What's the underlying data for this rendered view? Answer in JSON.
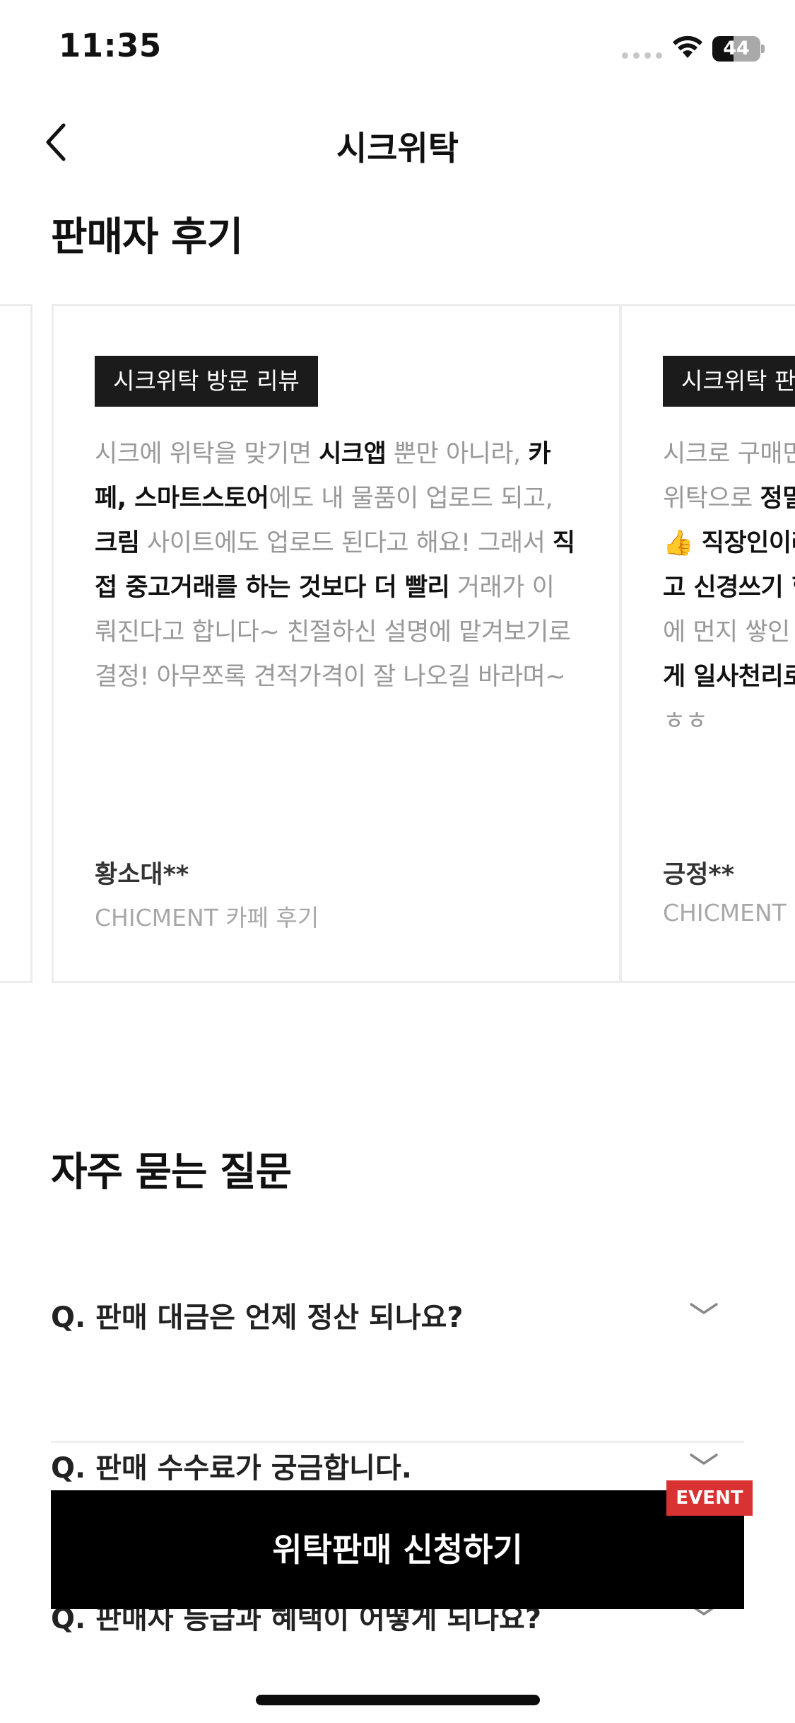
{
  "status_bar": {
    "time": "11:35",
    "battery_level": "44",
    "battery_fraction": 0.44
  },
  "nav": {
    "title": "시크위탁",
    "back_icon": "chevron-left-icon"
  },
  "reviews": {
    "title": "판매자 후기",
    "cards": [
      {
        "tag": "",
        "segments": [],
        "author": "",
        "source": ""
      },
      {
        "tag": "시크위탁 방문 리뷰",
        "segments": [
          {
            "text": "시크에 위탁을 맞기면 ",
            "bold": false
          },
          {
            "text": "시크앱",
            "bold": true
          },
          {
            "text": " 뿐만 아니라, ",
            "bold": false
          },
          {
            "text": "카페, 스마트스토어",
            "bold": true
          },
          {
            "text": "에도 내 물품이 업로드 되고, ",
            "bold": false
          },
          {
            "text": "크림",
            "bold": true
          },
          {
            "text": " 사이트에도 업로드 된다고 해요! 그래서 ",
            "bold": false
          },
          {
            "text": "직접 중고거래를 하는 것보다 더 빨리",
            "bold": true
          },
          {
            "text": " 거래가 이뤄진다고 합니다~ 친절하신 설명에 맡겨보기로 결정! 아무쪼록 견적가격이 잘 나오길 바라며~",
            "bold": false
          }
        ],
        "author": "황소대**",
        "source": "CHICMENT 카페 후기"
      },
      {
        "tag": "시크위탁 판",
        "segments": [
          {
            "text": "시크로 구매민",
            "bold": false
          },
          {
            "text": "\n위탁으로 ",
            "bold": false
          },
          {
            "text": "정밀",
            "bold": true
          },
          {
            "text": "\n👍 직장인이라",
            "bold": true
          },
          {
            "text": "\n고 신경쓰기 힘",
            "bold": true
          },
          {
            "text": "\n에 먼지 쌓인 ",
            "bold": false
          },
          {
            "text": "\n게 일사천리로",
            "bold": true
          },
          {
            "text": "\nㅎㅎ",
            "bold": false
          }
        ],
        "author": "긍정**",
        "source": "CHICMENT"
      }
    ]
  },
  "faq": {
    "title": "자주 묻는 질문",
    "chevron_icon": "chevron-down-icon",
    "items": [
      {
        "q": "Q.  판매 대금은 언제 정산 되나요?"
      },
      {
        "q": "Q.  판매 수수료가 궁금합니다."
      },
      {
        "q": "Q.  판매자 등급과 혜택이 어떻게 되나요?"
      }
    ]
  },
  "cta": {
    "label": "위탁판매 신청하기",
    "badge": "EVENT"
  },
  "colors": {
    "cta_bg": "#000000",
    "badge_bg": "#d93232",
    "tag_bg": "#1b1b1b",
    "muted_text": "#999999"
  }
}
